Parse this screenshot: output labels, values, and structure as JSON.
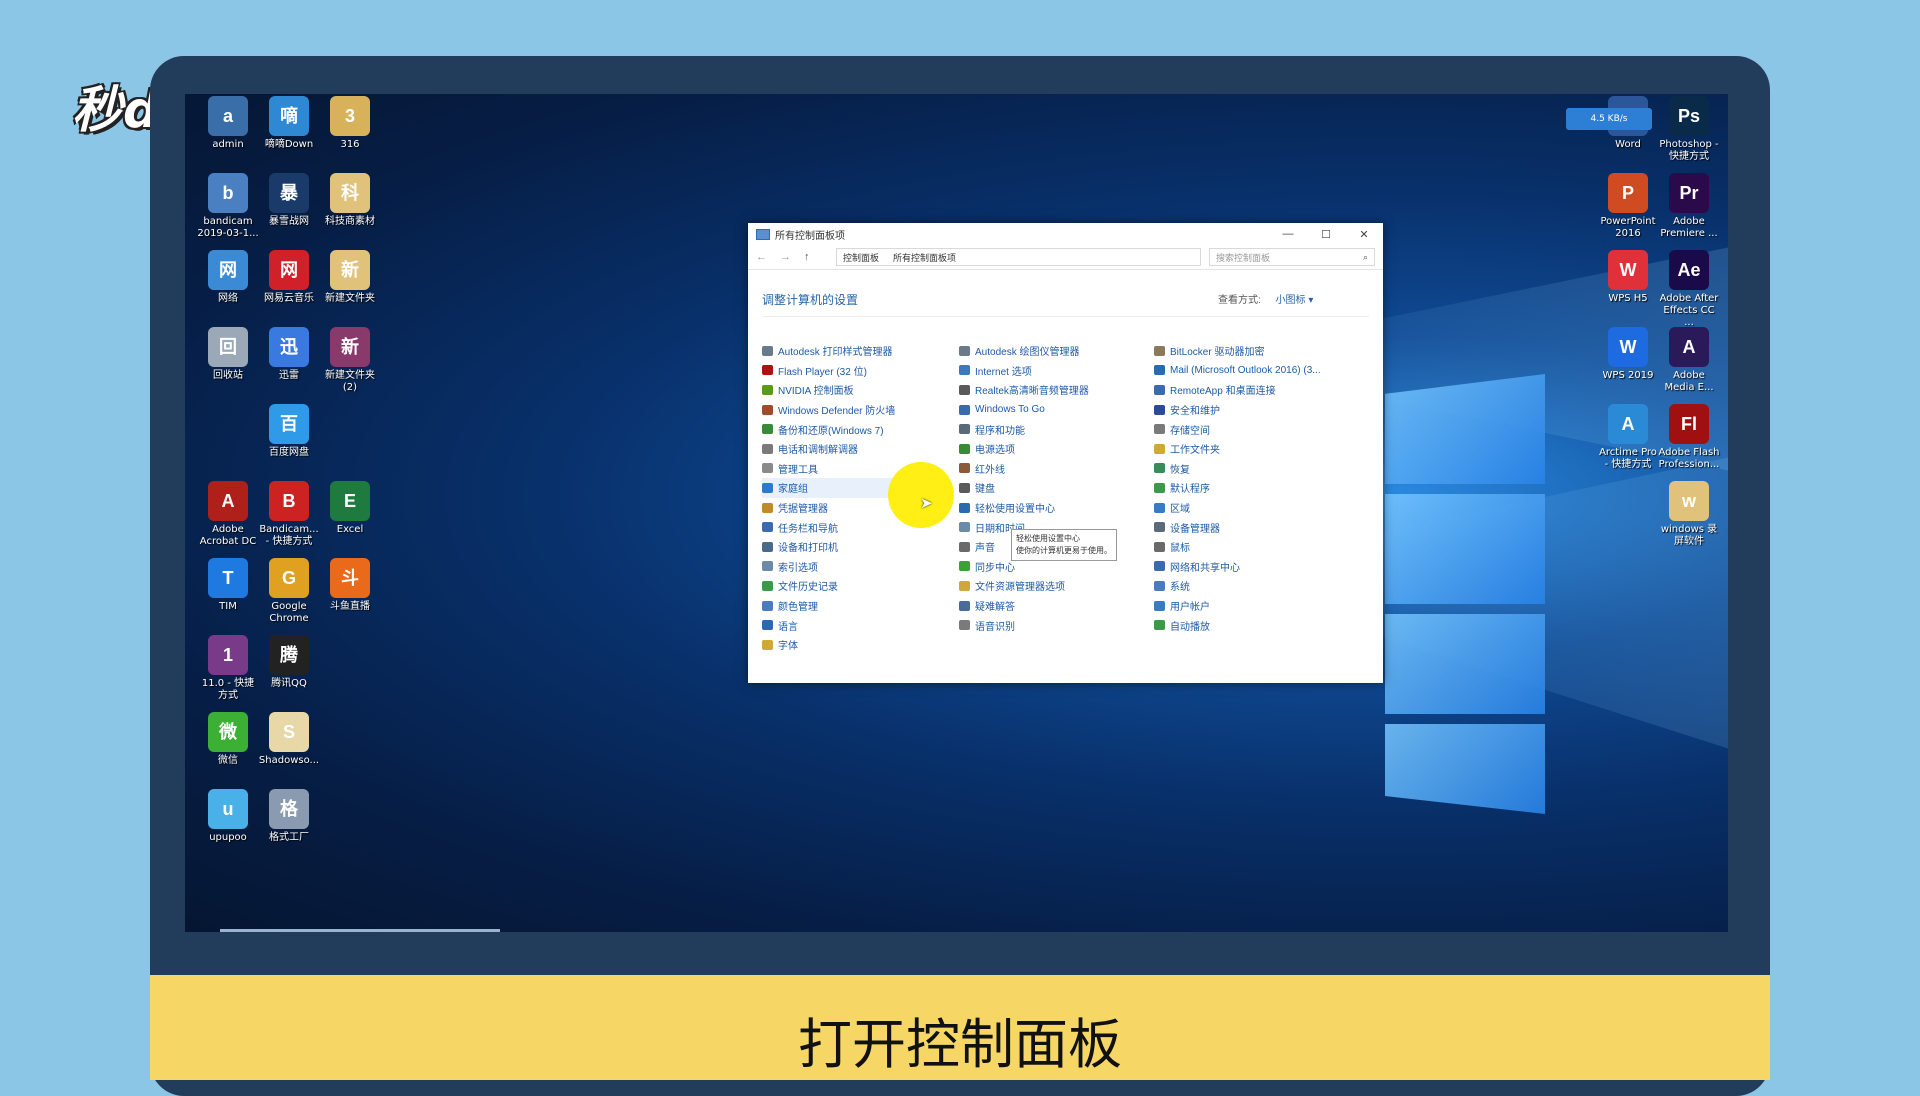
{
  "logo": "秒dong视频",
  "subtitle": "打开控制面板",
  "tray_badge": "4.5 KB/s",
  "desktop_icons_left": [
    {
      "label": "admin",
      "icon": "user-folder-icon",
      "color": "#3a6ea8"
    },
    {
      "label": "嘀嘀Down",
      "icon": "download-icon",
      "color": "#2e88d4"
    },
    {
      "label": "316",
      "icon": "folder-icon",
      "color": "#d8b25a"
    },
    {
      "label": "bandicam 2019-03-1...",
      "icon": "video-file-icon",
      "color": "#4a7fc1"
    },
    {
      "label": "暴雪战网",
      "icon": "battlenet-icon",
      "color": "#1a3a6a"
    },
    {
      "label": "科技商素材",
      "icon": "folder-icon",
      "color": "#e0c27a"
    },
    {
      "label": "网络",
      "icon": "network-icon",
      "color": "#3a8ad6"
    },
    {
      "label": "网易云音乐",
      "icon": "netease-music-icon",
      "color": "#d0202a"
    },
    {
      "label": "新建文件夹",
      "icon": "folder-icon",
      "color": "#e0c27a"
    },
    {
      "label": "回收站",
      "icon": "recycle-bin-icon",
      "color": "#9aa8b8"
    },
    {
      "label": "迅雷",
      "icon": "xunlei-icon",
      "color": "#3a7ae0"
    },
    {
      "label": "新建文件夹 (2)",
      "icon": "winrar-icon",
      "color": "#8a3a6a"
    },
    {
      "label": "百度网盘",
      "icon": "baidu-netdisk-icon",
      "color": "#2e9ae8"
    },
    {
      "label": "Adobe Acrobat DC",
      "icon": "acrobat-icon",
      "color": "#b0201a"
    },
    {
      "label": "Bandicam... - 快捷方式",
      "icon": "bandicam-icon",
      "color": "#cc2222"
    },
    {
      "label": "Excel",
      "icon": "excel-icon",
      "color": "#1e7a3e"
    },
    {
      "label": "TIM",
      "icon": "tim-icon",
      "color": "#1e7ae0"
    },
    {
      "label": "Google Chrome",
      "icon": "chrome-icon",
      "color": "#e0a020"
    },
    {
      "label": "斗鱼直播",
      "icon": "douyu-icon",
      "color": "#e86a1a"
    },
    {
      "label": "11.0 - 快捷方式",
      "icon": "winrar-icon",
      "color": "#7a3a8a"
    },
    {
      "label": "腾讯QQ",
      "icon": "qq-icon",
      "color": "#222222"
    },
    {
      "label": "微信",
      "icon": "wechat-icon",
      "color": "#3cb034"
    },
    {
      "label": "Shadowso...",
      "icon": "file-icon",
      "color": "#e8d8a8"
    },
    {
      "label": "upupoo",
      "icon": "upupoo-icon",
      "color": "#4ab0e8"
    },
    {
      "label": "格式工厂",
      "icon": "format-factory-icon",
      "color": "#8a9ab0"
    }
  ],
  "desktop_icons_right": [
    {
      "label": "Word",
      "icon": "word-icon",
      "color": "#2b579a"
    },
    {
      "label": "Photoshop - 快捷方式",
      "icon": "photoshop-icon",
      "color": "#0a2a4a",
      "text": "Ps"
    },
    {
      "label": "PowerPoint 2016",
      "icon": "powerpoint-icon",
      "color": "#d04a22",
      "text": "P"
    },
    {
      "label": "Adobe Premiere ...",
      "icon": "premiere-icon",
      "color": "#2a0a4a",
      "text": "Pr"
    },
    {
      "label": "WPS H5",
      "icon": "wps-h5-icon",
      "color": "#e0303a"
    },
    {
      "label": "Adobe After Effects CC ...",
      "icon": "after-effects-icon",
      "color": "#1a0a4a",
      "text": "Ae"
    },
    {
      "label": "WPS 2019",
      "icon": "wps-icon",
      "color": "#1e6ae0",
      "text": "W"
    },
    {
      "label": "Adobe Media E...",
      "icon": "media-encoder-icon",
      "color": "#2a1a5a"
    },
    {
      "label": "Arctime Pro - 快捷方式",
      "icon": "arctime-icon",
      "color": "#2a8ad6",
      "text": "A"
    },
    {
      "label": "Adobe Flash Profession...",
      "icon": "flash-icon",
      "color": "#a01010",
      "text": "Fl"
    },
    {
      "label": "windows 录屏软件",
      "icon": "folder-icon",
      "color": "#e0c27a"
    }
  ],
  "control_panel": {
    "title": "所有控制面板项",
    "window_buttons": [
      "—",
      "☐",
      "✕"
    ],
    "nav": [
      "←",
      "→",
      "↑"
    ],
    "breadcrumbs": [
      "控制面板",
      "所有控制面板项"
    ],
    "search_placeholder": "搜索控制面板",
    "heading": "调整计算机的设置",
    "view_by_label": "查看方式:",
    "view_by_value": "小图标 ▾",
    "tooltip_line1": "轻松使用设置中心",
    "tooltip_line2": "使你的计算机更易于使用。",
    "columns": [
      [
        {
          "label": "Autodesk 打印样式管理器",
          "icon": "autodesk-print-icon",
          "color": "#6a7a8a"
        },
        {
          "label": "Flash Player (32 位)",
          "icon": "flash-player-icon",
          "color": "#b01010"
        },
        {
          "label": "NVIDIA 控制面板",
          "icon": "nvidia-icon",
          "color": "#5a9a1a"
        },
        {
          "label": "Windows Defender 防火墙",
          "icon": "firewall-icon",
          "color": "#a04a2a"
        },
        {
          "label": "备份和还原(Windows 7)",
          "icon": "backup-icon",
          "color": "#3a8a3a"
        },
        {
          "label": "电话和调制解调器",
          "icon": "phone-modem-icon",
          "color": "#7a7a7a"
        },
        {
          "label": "管理工具",
          "icon": "admin-tools-icon",
          "color": "#8a8a8a"
        },
        {
          "label": "家庭组",
          "icon": "homegroup-icon",
          "color": "#2a7ad0"
        },
        {
          "label": "凭据管理器",
          "icon": "credential-icon",
          "color": "#c08a2a"
        },
        {
          "label": "任务栏和导航",
          "icon": "taskbar-icon",
          "color": "#3a6ab0"
        },
        {
          "label": "设备和打印机",
          "icon": "printer-icon",
          "color": "#4a6a8a"
        },
        {
          "label": "索引选项",
          "icon": "indexing-icon",
          "color": "#6a8aa8"
        },
        {
          "label": "文件历史记录",
          "icon": "file-history-icon",
          "color": "#3a9a4a"
        },
        {
          "label": "颜色管理",
          "icon": "color-management-icon",
          "color": "#4a7ac0"
        },
        {
          "label": "语言",
          "icon": "language-icon",
          "color": "#2a6ab0"
        },
        {
          "label": "字体",
          "icon": "fonts-icon",
          "color": "#d0a83a"
        }
      ],
      [
        {
          "label": "Autodesk 绘图仪管理器",
          "icon": "autodesk-plotter-icon",
          "color": "#6a7a8a"
        },
        {
          "label": "Internet 选项",
          "icon": "internet-options-icon",
          "color": "#3a7ac0"
        },
        {
          "label": "Realtek高清晰音频管理器",
          "icon": "realtek-icon",
          "color": "#5a5a5a"
        },
        {
          "label": "Windows To Go",
          "icon": "windows-to-go-icon",
          "color": "#3a6ab0"
        },
        {
          "label": "程序和功能",
          "icon": "programs-icon",
          "color": "#5a6a7a"
        },
        {
          "label": "电源选项",
          "icon": "power-icon",
          "color": "#3a8a3a"
        },
        {
          "label": "红外线",
          "icon": "infrared-icon",
          "color": "#8a5a3a"
        },
        {
          "label": "键盘",
          "icon": "keyboard-icon",
          "color": "#5a5a5a"
        },
        {
          "label": "轻松使用设置中心",
          "icon": "ease-of-access-icon",
          "color": "#2a6ab0"
        },
        {
          "label": "日期和时间",
          "icon": "datetime-icon",
          "color": "#6a8aa8"
        },
        {
          "label": "声音",
          "icon": "sound-icon",
          "color": "#6a6a6a"
        },
        {
          "label": "同步中心",
          "icon": "sync-icon",
          "color": "#3aa03a"
        },
        {
          "label": "文件资源管理器选项",
          "icon": "explorer-options-icon",
          "color": "#d0a83a"
        },
        {
          "label": "疑难解答",
          "icon": "troubleshoot-icon",
          "color": "#4a6a9a"
        },
        {
          "label": "语音识别",
          "icon": "speech-icon",
          "color": "#7a7a7a"
        }
      ],
      [
        {
          "label": "BitLocker 驱动器加密",
          "icon": "bitlocker-icon",
          "color": "#8a7a5a"
        },
        {
          "label": "Mail (Microsoft Outlook 2016) (3...",
          "icon": "mail-icon",
          "color": "#2a6ab0"
        },
        {
          "label": "RemoteApp 和桌面连接",
          "icon": "remoteapp-icon",
          "color": "#3a6ab0"
        },
        {
          "label": "安全和维护",
          "icon": "security-flag-icon",
          "color": "#2a4a9a"
        },
        {
          "label": "存储空间",
          "icon": "storage-icon",
          "color": "#7a7a7a"
        },
        {
          "label": "工作文件夹",
          "icon": "work-folders-icon",
          "color": "#d0a83a"
        },
        {
          "label": "恢复",
          "icon": "recovery-icon",
          "color": "#3a8a5a"
        },
        {
          "label": "默认程序",
          "icon": "default-programs-icon",
          "color": "#3a9a4a"
        },
        {
          "label": "区域",
          "icon": "region-icon",
          "color": "#3a7ac0"
        },
        {
          "label": "设备管理器",
          "icon": "device-manager-icon",
          "color": "#5a6a7a"
        },
        {
          "label": "鼠标",
          "icon": "mouse-icon",
          "color": "#6a6a6a"
        },
        {
          "label": "网络和共享中心",
          "icon": "network-sharing-icon",
          "color": "#3a6ab0"
        },
        {
          "label": "系统",
          "icon": "system-icon",
          "color": "#4a7ac0"
        },
        {
          "label": "用户帐户",
          "icon": "user-accounts-icon",
          "color": "#3a7ac0"
        },
        {
          "label": "自动播放",
          "icon": "autoplay-icon",
          "color": "#3a9a4a"
        }
      ]
    ]
  }
}
